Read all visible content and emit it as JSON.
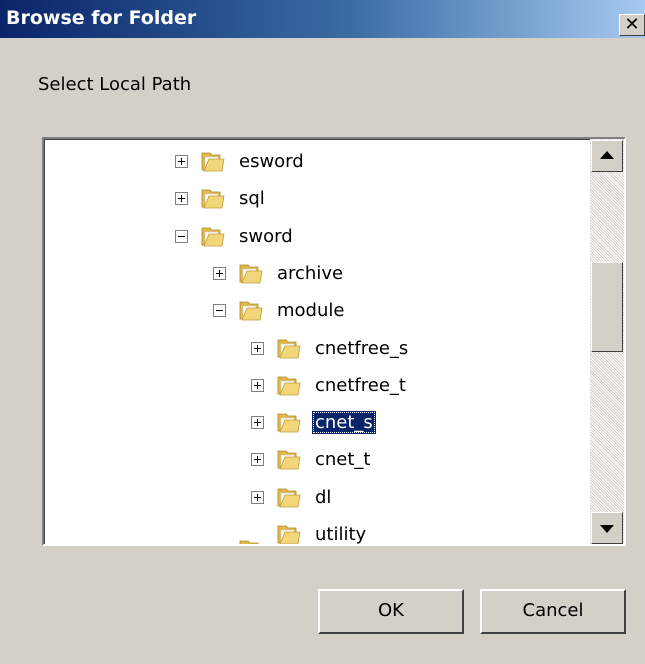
{
  "window": {
    "title": "Browse for Folder",
    "close_glyph": "✕"
  },
  "prompt": "Select Local Path",
  "tree": {
    "items": [
      {
        "label": "esword",
        "depth": 0,
        "expander": "plus",
        "selected": false
      },
      {
        "label": "sql",
        "depth": 0,
        "expander": "plus",
        "selected": false
      },
      {
        "label": "sword",
        "depth": 0,
        "expander": "minus",
        "selected": false
      },
      {
        "label": "archive",
        "depth": 1,
        "expander": "plus",
        "selected": false
      },
      {
        "label": "module",
        "depth": 1,
        "expander": "minus",
        "selected": false
      },
      {
        "label": "cnetfree_s",
        "depth": 2,
        "expander": "plus",
        "selected": false
      },
      {
        "label": "cnetfree_t",
        "depth": 2,
        "expander": "plus",
        "selected": false
      },
      {
        "label": "cnet_s",
        "depth": 2,
        "expander": "plus",
        "selected": true
      },
      {
        "label": "cnet_t",
        "depth": 2,
        "expander": "plus",
        "selected": false
      },
      {
        "label": "dl",
        "depth": 2,
        "expander": "plus",
        "selected": false
      },
      {
        "label": "utility",
        "depth": 2,
        "expander": "none",
        "selected": false
      }
    ]
  },
  "buttons": {
    "ok": "OK",
    "cancel": "Cancel"
  },
  "colors": {
    "selection": "#0a246a",
    "folder": "#e8c85a"
  }
}
